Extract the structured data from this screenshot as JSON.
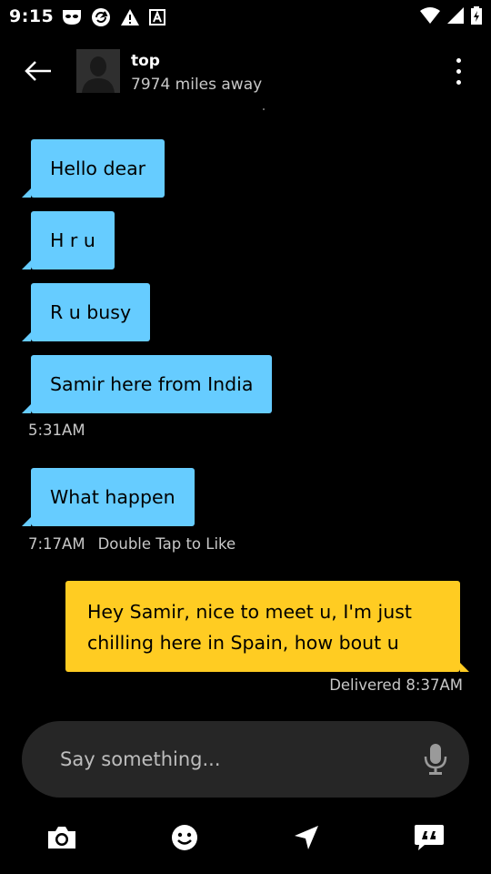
{
  "status_bar": {
    "time": "9:15",
    "left_icons": [
      "app-mask-icon",
      "sync-icon",
      "warning-icon",
      "a-box-icon"
    ],
    "right_icons": [
      "wifi-icon",
      "signal-icon",
      "battery-icon"
    ]
  },
  "header": {
    "name": "top",
    "distance": "7974 miles away"
  },
  "messages": [
    {
      "direction": "in",
      "text": "Hello dear"
    },
    {
      "direction": "in",
      "text": "H r u"
    },
    {
      "direction": "in",
      "text": "R u busy"
    },
    {
      "direction": "in",
      "text": "Samir here from India",
      "time": "5:31AM"
    },
    {
      "direction": "in",
      "text": "What happen",
      "time": "7:17AM",
      "hint": "Double Tap to Like"
    },
    {
      "direction": "out",
      "text_line1": "Hey Samir, nice to meet u, I'm just",
      "text_line2": "chilling here in Spain, how bout u",
      "status": "Delivered 8:37AM"
    }
  ],
  "composer": {
    "placeholder": "Say something..."
  },
  "toolbar": {
    "icons": [
      "camera-icon",
      "emoji-icon",
      "location-icon",
      "quick-reply-icon"
    ]
  },
  "colors": {
    "incoming_bubble": "#66ccff",
    "outgoing_bubble": "#ffcc22",
    "background": "#000000",
    "input_background": "#262626"
  }
}
